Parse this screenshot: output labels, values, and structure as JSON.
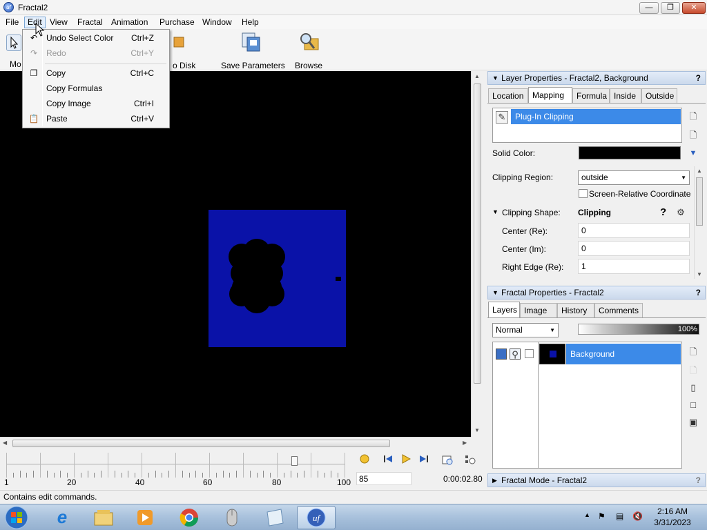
{
  "window": {
    "title": "Fractal2",
    "app_icon_text": "uf"
  },
  "menu": [
    "File",
    "Edit",
    "View",
    "Fractal",
    "Animation",
    "Purchase",
    "Window",
    "Help"
  ],
  "toolbar": {
    "mode_label": "Mo",
    "disk_label": "o Disk",
    "save_params_label": "Save Parameters",
    "browse_label": "Browse"
  },
  "edit_menu": {
    "items": [
      {
        "label": "Undo Select Color",
        "shortcut": "Ctrl+Z",
        "enabled": true
      },
      {
        "label": "Redo",
        "shortcut": "Ctrl+Y",
        "enabled": false
      },
      {
        "label": "Copy",
        "shortcut": "Ctrl+C",
        "enabled": true
      },
      {
        "label": "Copy Formulas",
        "shortcut": "",
        "enabled": true
      },
      {
        "label": "Copy Image",
        "shortcut": "Ctrl+I",
        "enabled": true
      },
      {
        "label": "Paste",
        "shortcut": "Ctrl+V",
        "enabled": true
      }
    ]
  },
  "timeline": {
    "ticks": [
      "1",
      "20",
      "40",
      "60",
      "80",
      "100"
    ],
    "frame_value": "85",
    "slider_position": 0.85,
    "time": "0:00:02.80"
  },
  "layer_properties": {
    "header": "Layer Properties - Fractal2, Background",
    "tabs": [
      "Location",
      "Mapping",
      "Formula",
      "Inside",
      "Outside"
    ],
    "selected_tab": "Mapping",
    "list_item": "Plug-In Clipping",
    "solid_color_label": "Solid Color:",
    "solid_color_value": "#000000",
    "clipping_region_label": "Clipping Region:",
    "clipping_region_value": "outside",
    "screen_relative_label": "Screen-Relative Coordinates",
    "clipping_shape_label": "Clipping Shape:",
    "clipping_shape_value": "Clipping",
    "help_mark": "?",
    "params": [
      {
        "label": "Center (Re):",
        "value": "0"
      },
      {
        "label": "Center (Im):",
        "value": "0"
      },
      {
        "label": "Right Edge (Re):",
        "value": "1"
      }
    ]
  },
  "fractal_properties": {
    "header": "Fractal Properties - Fractal2",
    "tabs": [
      "Layers",
      "Image",
      "History",
      "Comments"
    ],
    "selected_tab": "Layers",
    "blend_mode": "Normal",
    "opacity": "100%",
    "layer_name": "Background"
  },
  "fractal_mode": {
    "header": "Fractal Mode - Fractal2"
  },
  "status": {
    "text": "Contains edit commands."
  },
  "taskbar": {
    "time": "2:16 AM",
    "date": "3/31/2023"
  },
  "colors": {
    "fractal_blue": "#0a12a8",
    "selection_blue": "#3c8ae8",
    "canvas_bg": "#000000"
  }
}
